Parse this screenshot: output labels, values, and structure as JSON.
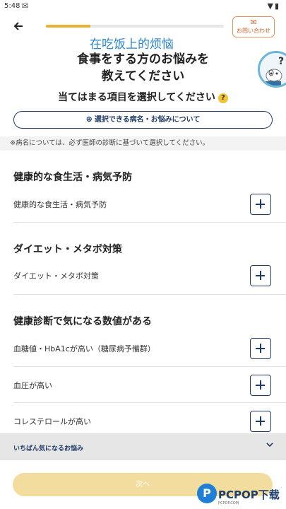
{
  "status_bar": {
    "time": "5:48",
    "notification_icon": "gmail-icon",
    "right_icons": [
      "wifi-icon",
      "battery-icon"
    ]
  },
  "header": {
    "back_icon": "arrow-left-icon",
    "progress_fraction": 0.25,
    "contact_label": "お問い合わせ",
    "contact_icon": "mail-icon"
  },
  "overlay_caption": "在吃饭上的烦恼",
  "title_line1": "食事をする方のお悩みを",
  "title_line2": "教えてください",
  "subtitle": "当てはまる項目を選択してください",
  "subtitle_help": "?",
  "about_button": "選択できる病名・お悩みについて",
  "note": "※病名については、必ず医師の診断に基づいて選択してください。",
  "sections": [
    {
      "heading": "健康的な食生活・病気予防",
      "items": [
        "健康的な食生活・病気予防"
      ]
    },
    {
      "heading": "ダイエット・メタボ対策",
      "items": [
        "ダイエット・メタボ対策"
      ]
    },
    {
      "heading": "健康診断で気になる数値がある",
      "items": [
        "血糖値・HbA1cが高い（糖尿病予備群）",
        "血圧が高い",
        "コレステロールが高い"
      ]
    }
  ],
  "bottom_bar": {
    "label": "いちばん気になるお悩み",
    "chevron_icon": "chevron-down-icon"
  },
  "next_button": "次へ",
  "watermark": {
    "logo_letter": "P",
    "text": "PCPOP下载",
    "sub": "PCPOP.COM"
  },
  "colors": {
    "accent_navy": "#1e3a66",
    "progress": "#e7b436",
    "next_disabled": "#f2dd9e",
    "contact": "#d2662e"
  }
}
